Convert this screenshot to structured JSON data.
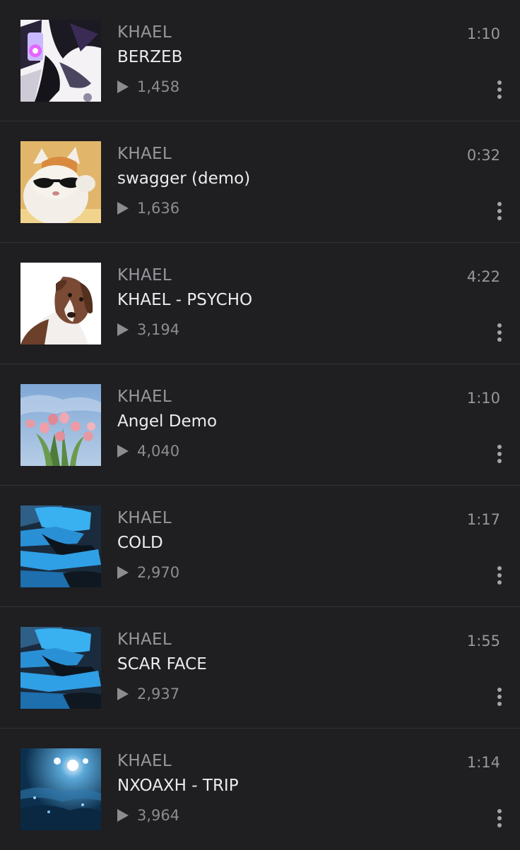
{
  "tracks": [
    {
      "artist": "KHAEL",
      "title": "BERZEB",
      "plays": "1,458",
      "duration": "1:10",
      "artwork": "dark-winged-figure-artwork"
    },
    {
      "artist": "KHAEL",
      "title": "swagger (demo)",
      "plays": "1,636",
      "duration": "0:32",
      "artwork": "cat-sunglasses-artwork"
    },
    {
      "artist": "KHAEL",
      "title": "KHAEL - PSYCHO",
      "plays": "3,194",
      "duration": "4:22",
      "artwork": "tilted-dog-artwork"
    },
    {
      "artist": "KHAEL",
      "title": "Angel Demo",
      "plays": "4,040",
      "duration": "1:10",
      "artwork": "pink-tulips-sky-artwork"
    },
    {
      "artist": "KHAEL",
      "title": "COLD",
      "plays": "2,970",
      "duration": "1:17",
      "artwork": "blue-blur-artwork"
    },
    {
      "artist": "KHAEL",
      "title": "SCAR FACE",
      "plays": "2,937",
      "duration": "1:55",
      "artwork": "blue-blur-artwork"
    },
    {
      "artist": "KHAEL",
      "title": "NXOAXH - TRIP",
      "plays": "3,964",
      "duration": "1:14",
      "artwork": "underwater-light-artwork"
    }
  ],
  "colors": {
    "background": "#1f1e21",
    "divider": "#323135",
    "primary_text": "#ececee",
    "secondary_text": "#98979c"
  },
  "icons": {
    "play": "play-icon",
    "more": "more-vertical-icon"
  }
}
